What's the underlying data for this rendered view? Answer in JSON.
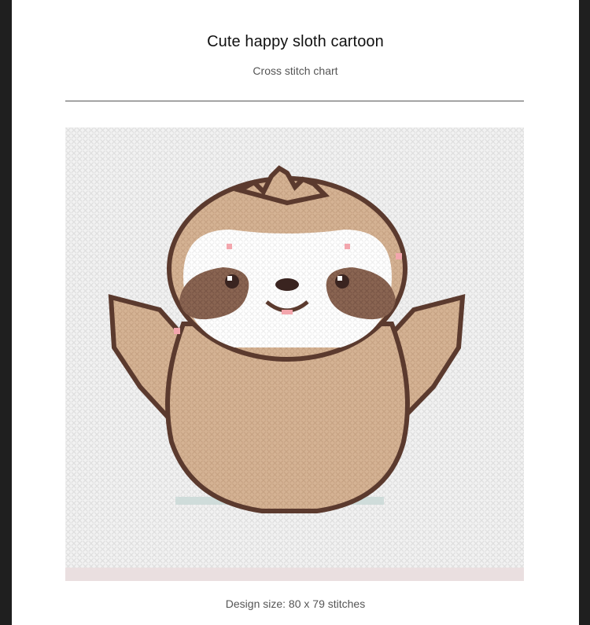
{
  "page": {
    "title": "Cute happy sloth cartoon",
    "subtitle": "Cross stitch chart",
    "design_size": "Design size: 80 x 79 stitches"
  },
  "chart_image": {
    "description": "sloth-cross-stitch-pattern",
    "grid_cols": 80,
    "grid_rows": 79,
    "colors": {
      "fabric": "#f2f2f2",
      "fabric_grid": "#dcdcdc",
      "body": "#d5b394",
      "body_dark": "#c39c7a",
      "outline": "#5b3a2e",
      "eye_patch": "#8a6552",
      "face": "#ffffff",
      "eye": "#3a2420",
      "cheek": "#f3a6ad",
      "shadow": "#cfdcda",
      "border_strip": "#eadfe0"
    }
  }
}
